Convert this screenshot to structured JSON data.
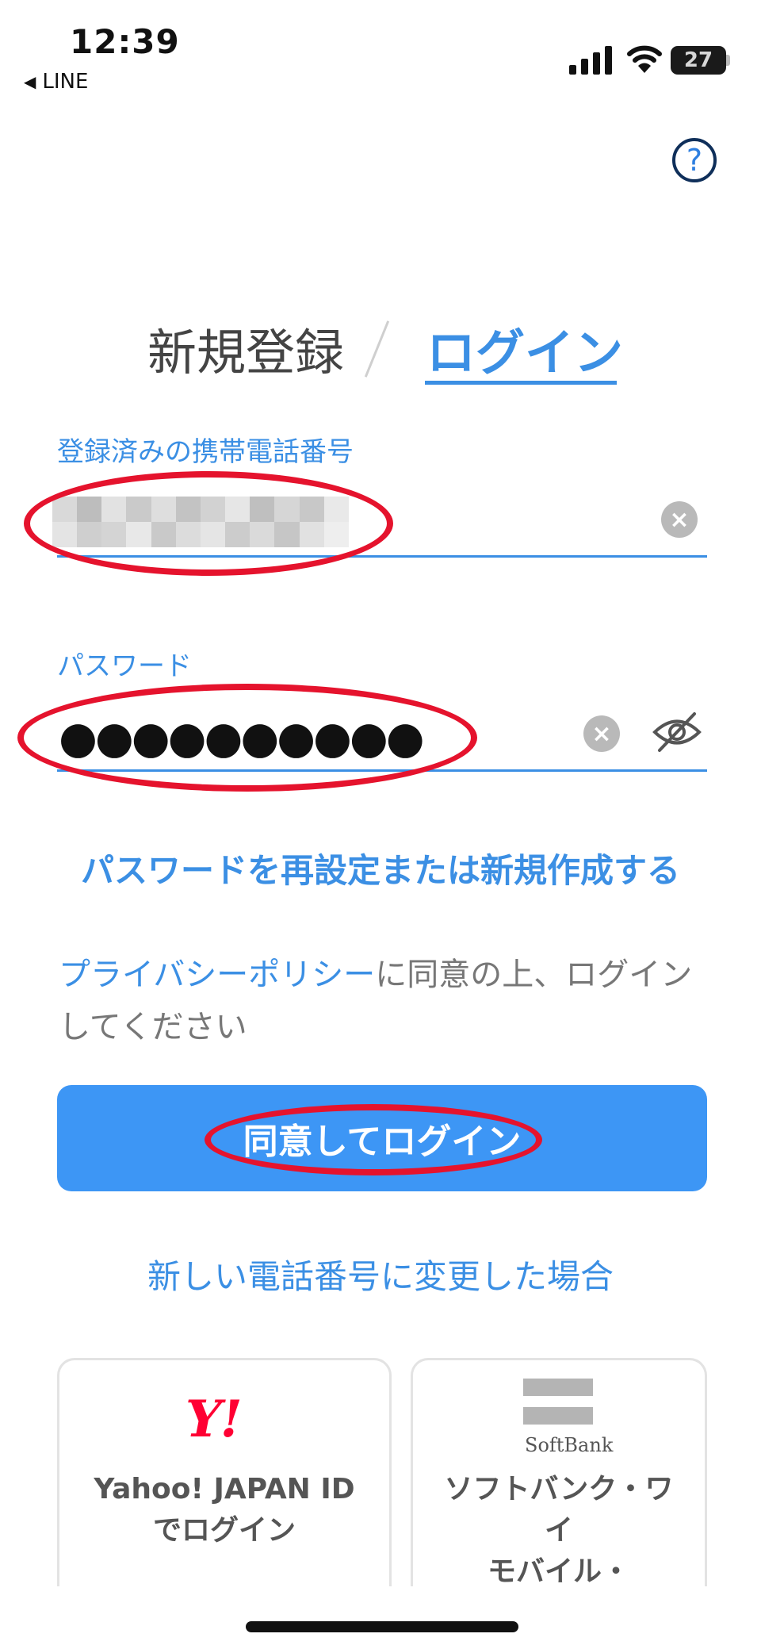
{
  "status_bar": {
    "time": "12:39",
    "back_app": "LINE",
    "battery": "27"
  },
  "tabs": {
    "register": "新規登録",
    "login": "ログイン"
  },
  "form": {
    "phone_label": "登録済みの携帯電話番号",
    "password_label": "パスワード",
    "password_mask": "●●●●●●●●●●"
  },
  "links": {
    "reset_password": "パスワードを再設定または新規作成する",
    "policy_link": "プライバシーポリシー",
    "policy_rest": "に同意の上、ログインしてください",
    "changed_number": "新しい電話番号に変更した場合"
  },
  "login_button": "同意してログイン",
  "cards": {
    "yahoo_logo": "Y!",
    "yahoo_line1": "Yahoo! JAPAN ID",
    "yahoo_line2": "でログイン",
    "softbank_logo": "SoftBank",
    "softbank_line1": "ソフトバンク・ワ",
    "softbank_line2": "イ",
    "softbank_line3": "モバイル・"
  },
  "colors": {
    "accent": "#3b8fe4",
    "button": "#3d96f5",
    "annotation_red": "#e5132d"
  }
}
